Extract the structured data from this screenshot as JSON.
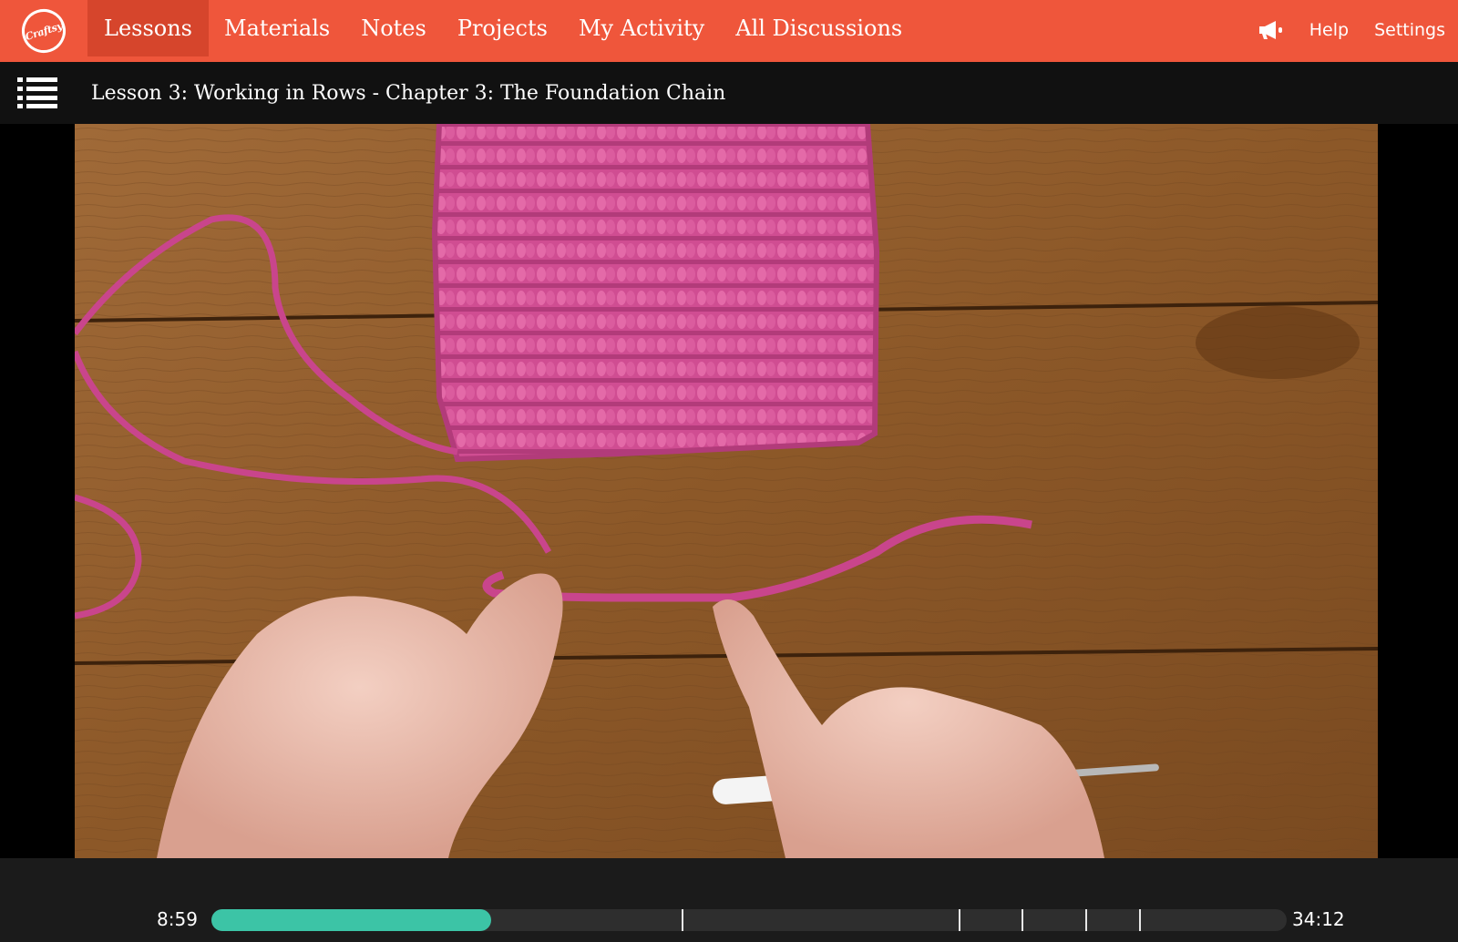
{
  "brand": {
    "logo_text": "Craftsy",
    "accent_color": "#ef563b",
    "active_tab_color": "#d6452c"
  },
  "nav": {
    "tabs": [
      {
        "label": "Lessons",
        "active": true
      },
      {
        "label": "Materials",
        "active": false
      },
      {
        "label": "Notes",
        "active": false
      },
      {
        "label": "Projects",
        "active": false
      },
      {
        "label": "My Activity",
        "active": false
      },
      {
        "label": "All Discussions",
        "active": false
      }
    ],
    "announce_icon": "megaphone-icon",
    "help_label": "Help",
    "settings_label": "Settings"
  },
  "lesson": {
    "menu_icon": "list-icon",
    "title": "Lesson 3: Working in Rows - Chapter 3: The Foundation Chain"
  },
  "player": {
    "current_time": "8:59",
    "total_time": "34:12",
    "progress_fraction": 0.26,
    "progress_color": "#3cc4a6",
    "chapter_marker_fractions": [
      0.437,
      0.695,
      0.753,
      0.813,
      0.863
    ]
  }
}
